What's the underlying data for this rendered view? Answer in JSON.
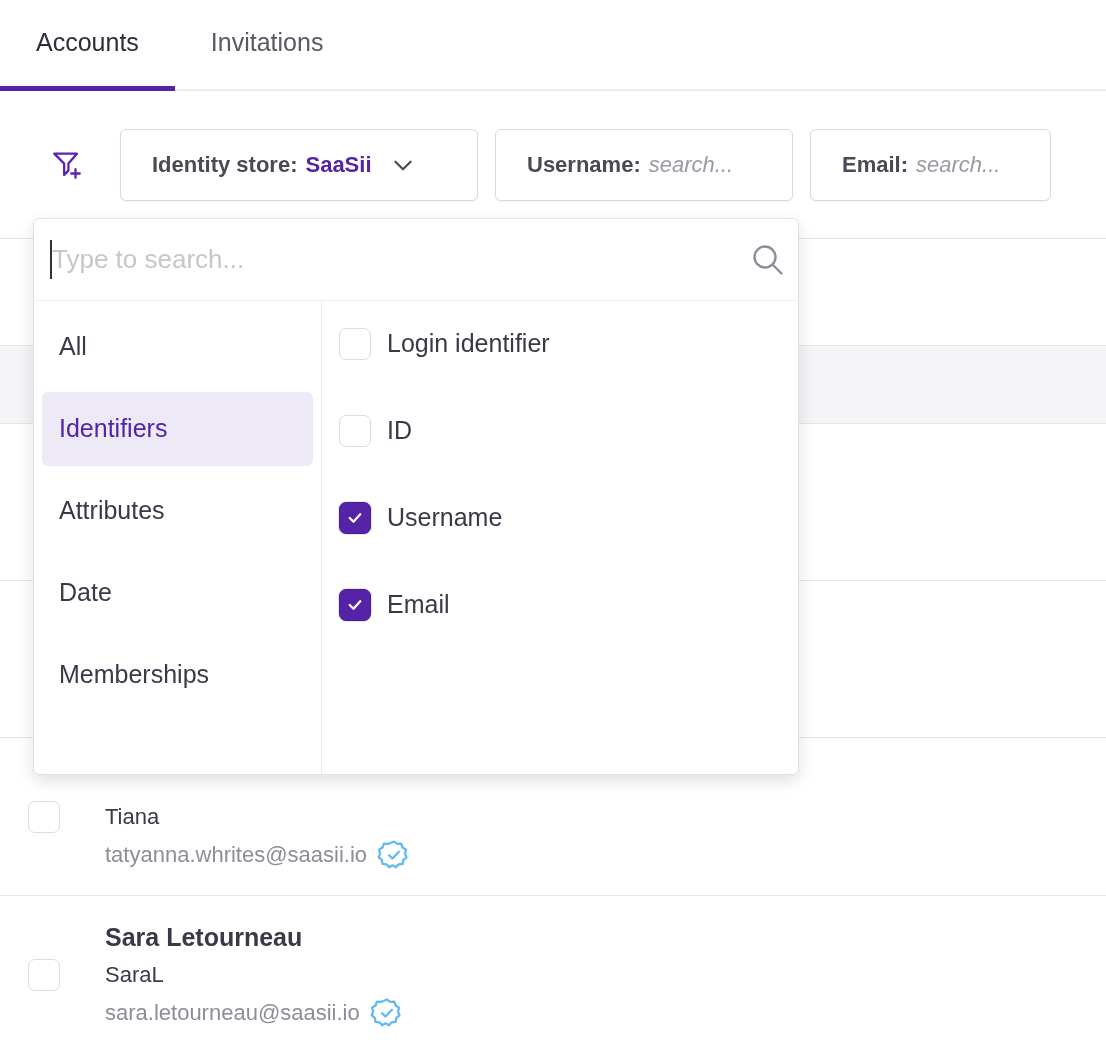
{
  "tabs": [
    {
      "label": "Accounts",
      "selected": true
    },
    {
      "label": "Invitations",
      "selected": false
    }
  ],
  "filters": [
    {
      "kind": "select",
      "label": "Identity store:",
      "value": "SaaSii"
    },
    {
      "kind": "search",
      "label": "Username:",
      "placeholder": "search..."
    },
    {
      "kind": "search",
      "label": "Email:",
      "placeholder": "search..."
    }
  ],
  "filter_menu": {
    "search": {
      "placeholder": "Type to search..."
    },
    "categories": [
      {
        "label": "All",
        "selected": false
      },
      {
        "label": "Identifiers",
        "selected": true
      },
      {
        "label": "Attributes",
        "selected": false
      },
      {
        "label": "Date",
        "selected": false
      },
      {
        "label": "Memberships",
        "selected": false
      }
    ],
    "options": [
      {
        "label": "Login identifier",
        "checked": false
      },
      {
        "label": "ID",
        "checked": false
      },
      {
        "label": "Username",
        "checked": true
      },
      {
        "label": "Email",
        "checked": true
      }
    ]
  },
  "accounts": [
    {
      "username": "Tiana",
      "email": "tatyanna.whrites@saasii.io",
      "verified": true,
      "checked": false
    },
    {
      "name": "Sara Letourneau",
      "username": "SaraL",
      "email": "sara.letourneau@saasii.io",
      "verified": true,
      "checked": false
    }
  ]
}
